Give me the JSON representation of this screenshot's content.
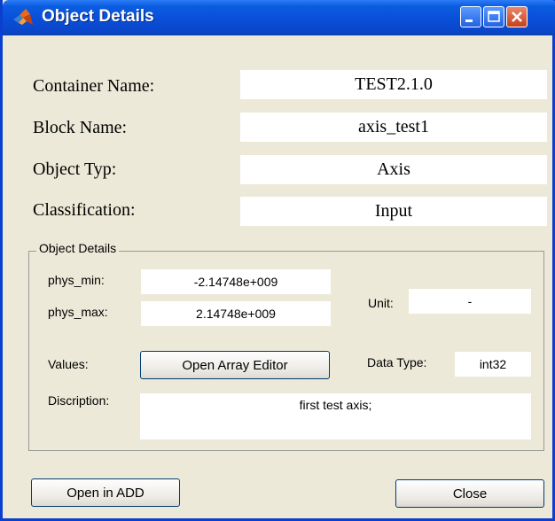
{
  "window": {
    "title": "Object Details",
    "icon": "matlab-logo-icon"
  },
  "fields": {
    "container_name_label": "Container Name:",
    "container_name_value": "TEST2.1.0",
    "block_name_label": "Block Name:",
    "block_name_value": "axis_test1",
    "object_type_label": "Object Typ:",
    "object_type_value": "Axis",
    "classification_label": "Classification:",
    "classification_value": "Input"
  },
  "details": {
    "group_title": "Object Details",
    "phys_min_label": "phys_min:",
    "phys_min_value": "-2.14748e+009",
    "phys_max_label": "phys_max:",
    "phys_max_value": "2.14748e+009",
    "unit_label": "Unit:",
    "unit_value": "-",
    "values_label": "Values:",
    "open_array_editor_label": "Open Array Editor",
    "data_type_label": "Data Type:",
    "data_type_value": "int32",
    "description_label": "Discription:",
    "description_value": "first test axis;"
  },
  "buttons": {
    "open_in_add_label": "Open in ADD",
    "close_label": "Close"
  },
  "colors": {
    "titlebar": "#0a4ed8",
    "window_bg": "#ece9d8",
    "close_button": "#c8401b"
  }
}
